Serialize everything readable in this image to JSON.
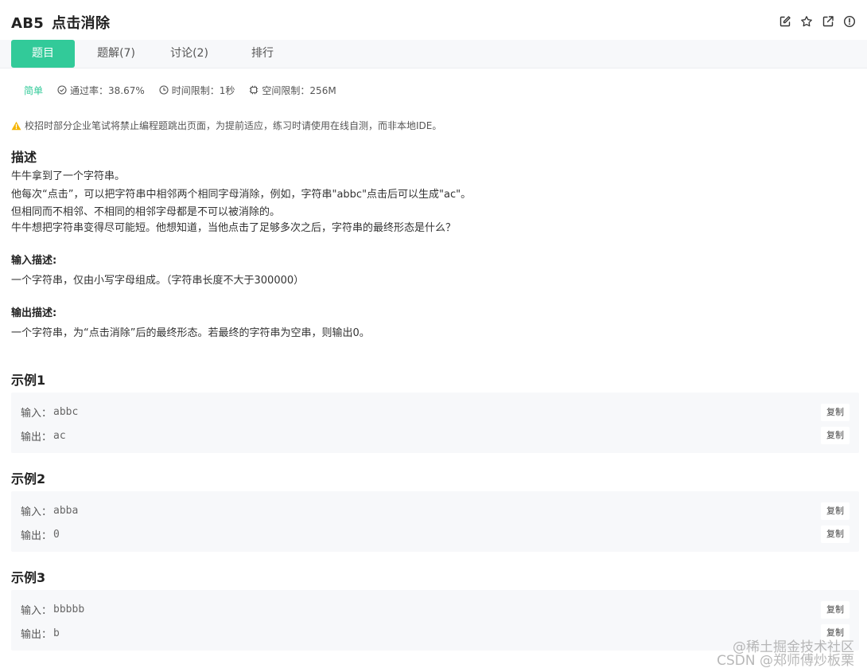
{
  "problem": {
    "code": "AB5",
    "title": "点击消除"
  },
  "header_icons": [
    "edit-icon",
    "star-icon",
    "share-icon",
    "info-icon"
  ],
  "tabs": [
    {
      "label": "题目",
      "active": true
    },
    {
      "label": "题解(7)",
      "active": false
    },
    {
      "label": "讨论(2)",
      "active": false
    },
    {
      "label": "排行",
      "active": false
    }
  ],
  "meta": {
    "level": "简单",
    "pass_rate": "通过率：38.67%",
    "time_limit": "时间限制：1秒",
    "space_limit": "空间限制：256M"
  },
  "notice": "校招时部分企业笔试将禁止编程题跳出页面，为提前适应，练习时请使用在线自测，而非本地IDE。",
  "description": {
    "heading": "描述",
    "lines": [
      "牛牛拿到了一个字符串。",
      "他每次“点击”，可以把字符串中相邻两个相同字母消除，例如，字符串\"abbc\"点击后可以生成\"ac\"。",
      "但相同而不相邻、不相同的相邻字母都是不可以被消除的。",
      "牛牛想把字符串变得尽可能短。他想知道，当他点击了足够多次之后，字符串的最终形态是什么？"
    ]
  },
  "input_desc": {
    "heading": "输入描述:",
    "text": "一个字符串，仅由小写字母组成。（字符串长度不大于300000）"
  },
  "output_desc": {
    "heading": "输出描述:",
    "text": "一个字符串，为“点击消除”后的最终形态。若最终的字符串为空串，则输出0。"
  },
  "examples": [
    {
      "title": "示例1",
      "input_label": "输入：",
      "input": "abbc",
      "output_label": "输出：",
      "output": "ac",
      "copy_label": "复制"
    },
    {
      "title": "示例2",
      "input_label": "输入：",
      "input": "abba",
      "output_label": "输出：",
      "output": "0",
      "copy_label": "复制"
    },
    {
      "title": "示例3",
      "input_label": "输入：",
      "input": "bbbbb",
      "output_label": "输出：",
      "output": "b",
      "copy_label": "复制"
    }
  ],
  "watermark": {
    "line1": "@稀土掘金技术社区",
    "line2": "CSDN @郑师傅炒板栗"
  },
  "colors": {
    "accent": "#32ca99",
    "warning": "#f5b400",
    "example_bg": "#f7f8fa"
  }
}
